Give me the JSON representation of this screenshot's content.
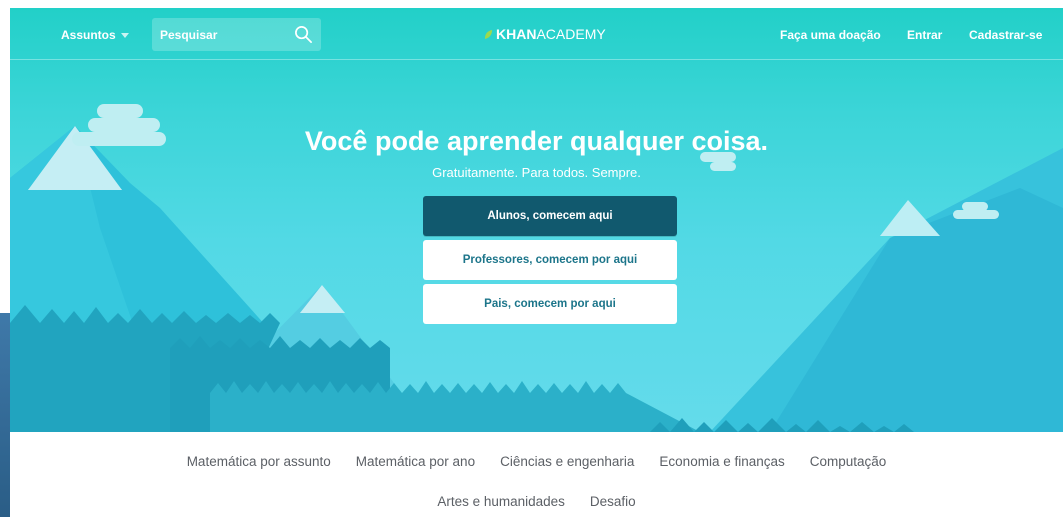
{
  "nav": {
    "subjects_label": "Assuntos",
    "search_placeholder": "Pesquisar",
    "logo_bold": "KHAN",
    "logo_light": "ACADEMY",
    "donate_label": "Faça uma doação",
    "login_label": "Entrar",
    "signup_label": "Cadastrar-se"
  },
  "hero": {
    "title": "Você pode aprender qualquer coisa.",
    "subtitle": "Gratuitamente. Para todos. Sempre.",
    "cta_students": "Alunos, comecem aqui",
    "cta_teachers": "Professores, comecem por aqui",
    "cta_parents": "Pais, comecem por aqui"
  },
  "subjects": {
    "row1": [
      "Matemática por assunto",
      "Matemática por ano",
      "Ciências e engenharia",
      "Economia e finanças",
      "Computação"
    ],
    "row2": [
      "Artes e humanidades",
      "Desafio"
    ]
  },
  "colors": {
    "hero_top": "#22d0c8",
    "hero_bottom": "#64dbeb",
    "primary_button": "#11596e",
    "secondary_text": "#1c758a",
    "subject_text": "#5c6066",
    "logo_leaf": "#9cd950"
  },
  "icons": {
    "search": "search-icon",
    "subjects_dropdown": "chevron-down-icon",
    "logo": "leaf-icon"
  }
}
